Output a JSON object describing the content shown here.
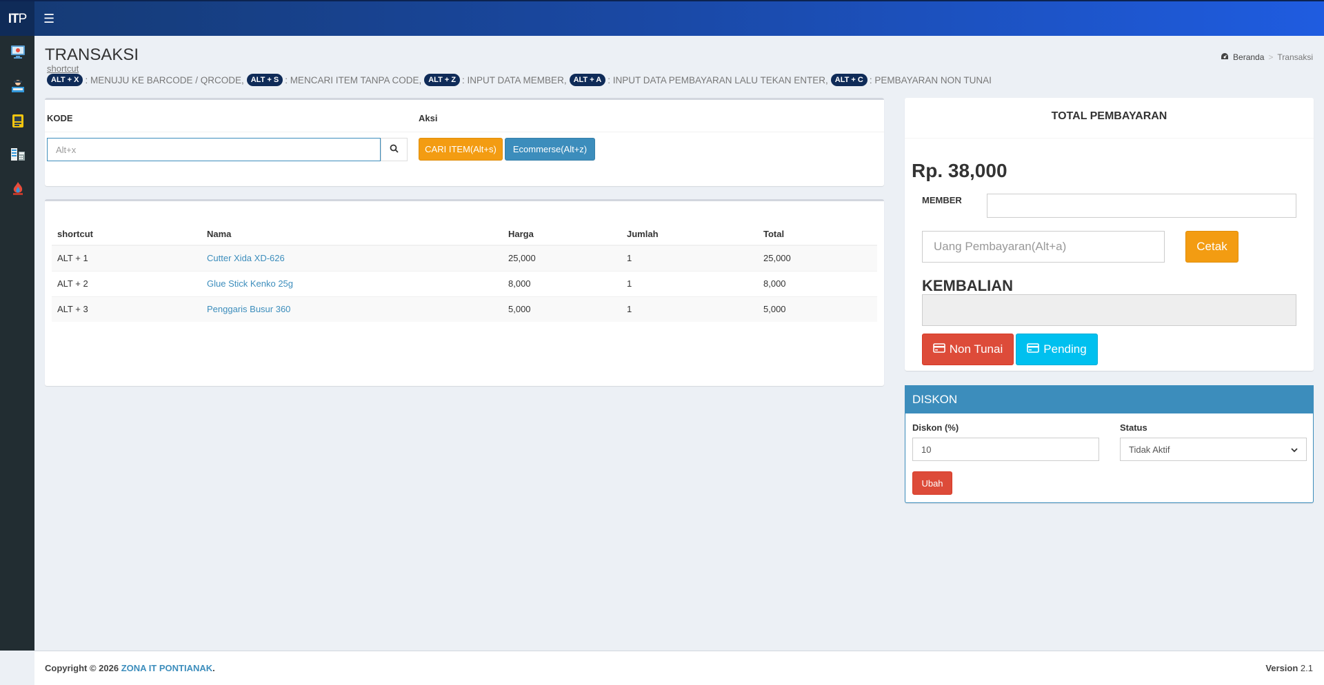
{
  "app": {
    "logo_main": "IT",
    "logo_sub": "P"
  },
  "sidebar": {
    "items": [
      {
        "name": "monitor-icon"
      },
      {
        "name": "cashier-icon"
      },
      {
        "name": "id-card-icon"
      },
      {
        "name": "calculator-icon"
      },
      {
        "name": "fire-icon"
      }
    ]
  },
  "page": {
    "title": "TRANSAKSI",
    "shortcut_label": "shortcut",
    "shortcuts": [
      {
        "key": "ALT + X",
        "text": ": MENUJU KE BARCODE / QRCODE,"
      },
      {
        "key": "ALT + S",
        "text": ": MENCARI ITEM TANPA CODE,"
      },
      {
        "key": "ALT + Z",
        "text": ": INPUT DATA MEMBER,"
      },
      {
        "key": "ALT + A",
        "text": ": INPUT DATA PEMBAYARAN LALU TEKAN ENTER,"
      },
      {
        "key": "ALT + C",
        "text": ": PEMBAYARAN NON TUNAI"
      }
    ]
  },
  "breadcrumb": {
    "home": "Beranda",
    "current": "Transaksi"
  },
  "code_panel": {
    "kode_header": "KODE",
    "aksi_header": "Aksi",
    "input_placeholder": "Alt+x",
    "cari_button": "CARI ITEM(Alt+s)",
    "ecommerse_button": "Ecommerse(Alt+z)"
  },
  "items_table": {
    "headers": [
      "shortcut",
      "Nama",
      "Harga",
      "Jumlah",
      "Total"
    ],
    "rows": [
      {
        "shortcut": "ALT + 1",
        "nama": "Cutter Xida XD-626",
        "harga": "25,000",
        "jumlah": "1",
        "total": "25,000"
      },
      {
        "shortcut": "ALT + 2",
        "nama": "Glue Stick Kenko 25g",
        "harga": "8,000",
        "jumlah": "1",
        "total": "8,000"
      },
      {
        "shortcut": "ALT + 3",
        "nama": "Penggaris Busur 360",
        "harga": "5,000",
        "jumlah": "1",
        "total": "5,000"
      }
    ]
  },
  "payment": {
    "title": "TOTAL PEMBAYARAN",
    "total": "Rp. 38,000",
    "member_label": "MEMBER",
    "member_value": "",
    "pay_placeholder": "Uang Pembayaran(Alt+a)",
    "cetak_button": "Cetak",
    "kembalian_label": "KEMBALIAN",
    "kembalian_value": "",
    "nontunai_button": "Non Tunai",
    "pending_button": "Pending"
  },
  "diskon": {
    "title": "DISKON",
    "diskon_label": "Diskon (%)",
    "diskon_value": "10",
    "status_label": "Status",
    "status_value": "Tidak Aktif",
    "ubah_button": "Ubah"
  },
  "footer": {
    "copyright_prefix": "Copyright © 2026",
    "company": "ZONA IT PONTIANAK",
    "copyright_suffix": ".",
    "version_label": "Version",
    "version_value": "2.1"
  },
  "colors": {
    "primary": "#3c8dbc",
    "warning": "#f39c12",
    "danger": "#dd4b39",
    "info": "#00c0ef",
    "sidebar": "#222d32",
    "header_dark": "#0f2b58"
  }
}
